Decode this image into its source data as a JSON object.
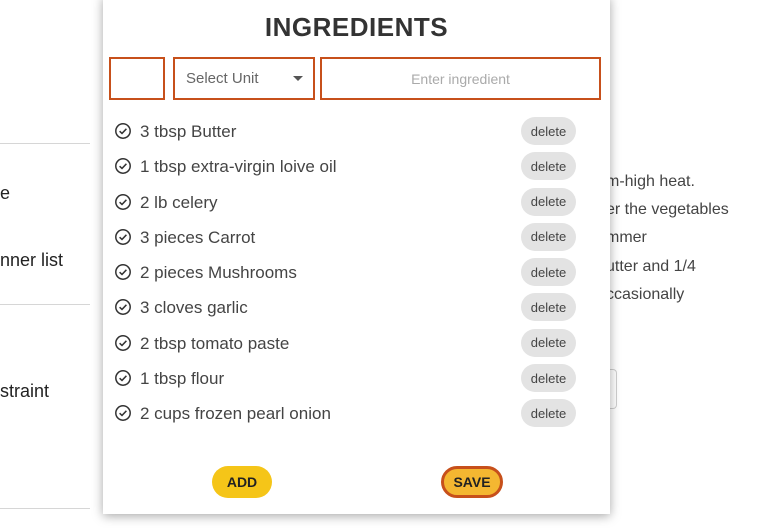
{
  "background": {
    "left_items": [
      "e",
      "nner list",
      "straint"
    ],
    "right_lines": [
      "m-high heat.",
      "er the vegetables",
      "mmer",
      "utter and 1/4",
      "ccasionally"
    ]
  },
  "modal": {
    "title": "INGREDIENTS",
    "quantity_value": "",
    "unit_select": {
      "selected": "Select Unit"
    },
    "ingredient_input": {
      "value": "",
      "placeholder": "Enter ingredient"
    },
    "items": [
      {
        "label": "3 tbsp Butter",
        "action": "delete"
      },
      {
        "label": "1 tbsp extra-virgin loive oil",
        "action": "delete"
      },
      {
        "label": "2 lb celery",
        "action": "delete"
      },
      {
        "label": "3 pieces Carrot",
        "action": "delete"
      },
      {
        "label": "2 pieces Mushrooms",
        "action": "delete"
      },
      {
        "label": "3 cloves garlic",
        "action": "delete"
      },
      {
        "label": "2 tbsp tomato paste",
        "action": "delete"
      },
      {
        "label": "1 tbsp flour",
        "action": "delete"
      },
      {
        "label": "2 cups frozen pearl onion",
        "action": "delete"
      }
    ],
    "add_label": "ADD",
    "save_label": "SAVE"
  },
  "colors": {
    "accent_border": "#c7501b",
    "button_yellow": "#f5c518",
    "delete_bg": "#e3e3e3"
  },
  "icons": {
    "item_icon": "check-circle-icon",
    "caret": "chevron-down-icon"
  }
}
